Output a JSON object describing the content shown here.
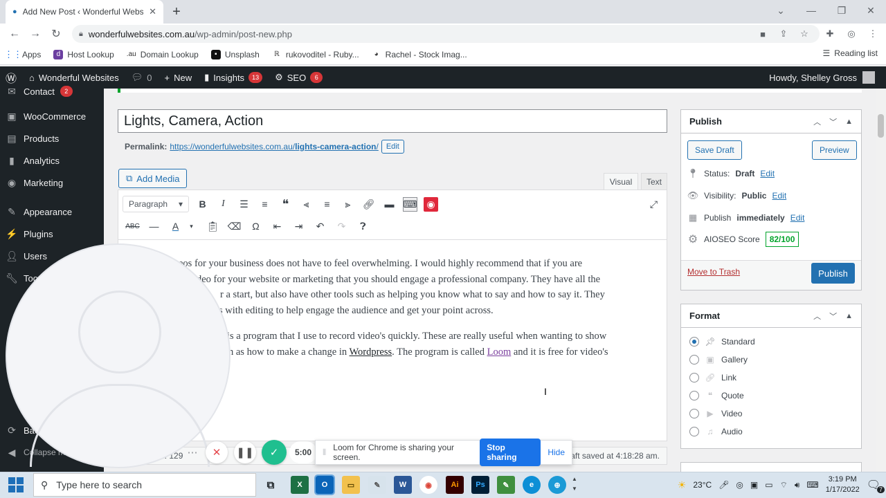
{
  "browser": {
    "tab_title": "Add New Post ‹ Wonderful Websites",
    "url_host": "wonderfulwebsites.com.au",
    "url_path": "/wp-admin/post-new.php",
    "bookmarks": [
      "Apps",
      "Host Lookup",
      "Domain Lookup",
      "Unsplash",
      "rukovoditel - Ruby...",
      "Rachel - Stock Imag..."
    ],
    "reading_list": "Reading list"
  },
  "adminbar": {
    "site_name": "Wonderful Websites",
    "comments_count": "0",
    "new_label": "New",
    "insights_label": "Insights",
    "insights_badge": "13",
    "seo_label": "SEO",
    "seo_badge": "6",
    "howdy": "Howdy, Shelley Gross"
  },
  "sidebar": {
    "items": [
      {
        "label": "Contact",
        "badge": "2"
      },
      {
        "label": "WooCommerce"
      },
      {
        "label": "Products"
      },
      {
        "label": "Analytics"
      },
      {
        "label": "Marketing"
      },
      {
        "label": "Appearance"
      },
      {
        "label": "Plugins"
      },
      {
        "label": "Users"
      },
      {
        "label": "Too"
      },
      {
        "label": "Bac"
      },
      {
        "label": "Collapse me"
      }
    ]
  },
  "post": {
    "title": "Lights, Camera, Action",
    "permalink_label": "Permalink:",
    "permalink_base": "https://wonderfulwebsites.com.au/",
    "permalink_slug": "lights-camera-action",
    "permalink_end": "/",
    "edit_label": "Edit",
    "add_media": "Add Media",
    "tab_visual": "Visual",
    "tab_text": "Text",
    "format_select": "Paragraph",
    "p1": "eos for your business does not have to feel overwhelming. I would highly recommend that if you are",
    "p1b": "deo for your website or marketing that you should engage a professional company. They have all the",
    "p1c": "r a start, but also have other tools such as helping you know what to say and how to say it. They",
    "p1d": "s with editing to help engage the audience and get your point across.",
    "p2": "is a program that I use to record video's quickly. These are really useful when wanting to show",
    "p2b_pre": "h as how to make a change in ",
    "p2b_link": "Wordpress",
    "p2b_mid": ". The program is called ",
    "p2b_link2": "Loom",
    "p2b_end": " and it is free for video's",
    "word_count": "n: 129",
    "draft_saved": "Draft saved at 4:18:28 am."
  },
  "publish": {
    "heading": "Publish",
    "save_draft": "Save Draft",
    "preview": "Preview",
    "status_label": "Status:",
    "status_value": "Draft",
    "visibility_label": "Visibility:",
    "visibility_value": "Public",
    "publish_label": "Publish",
    "publish_value": "immediately",
    "edit": "Edit",
    "aioseo_label": "AIOSEO Score",
    "aioseo_score": "82/100",
    "trash": "Move to Trash",
    "publish_btn": "Publish"
  },
  "format": {
    "heading": "Format",
    "options": [
      "Standard",
      "Gallery",
      "Link",
      "Quote",
      "Video",
      "Audio"
    ],
    "selected": "Standard"
  },
  "loom": {
    "timer": "5:00",
    "sharing_text": "Loom for Chrome is sharing your screen.",
    "stop_sharing": "Stop sharing",
    "hide": "Hide"
  },
  "taskbar": {
    "search_placeholder": "Type here to search",
    "temp": "23°C",
    "time": "3:19 PM",
    "date": "1/17/2022",
    "notif_count": "7"
  }
}
